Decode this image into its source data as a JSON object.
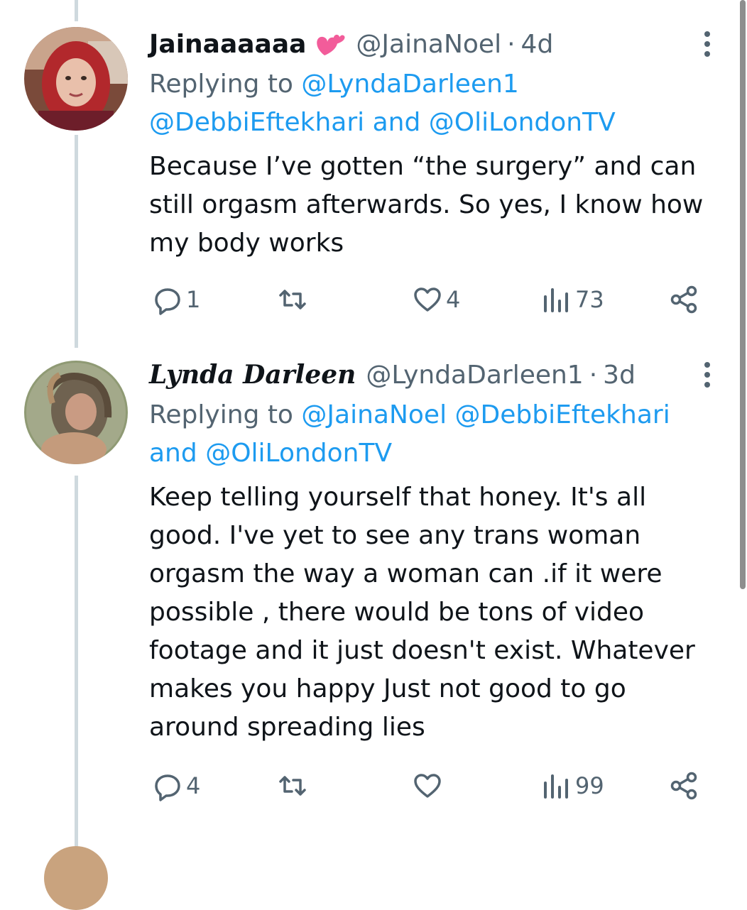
{
  "tweets": [
    {
      "display_name": "Jainaaaaaa",
      "name_emoji": "two-hearts",
      "handle": "@JainaNoel",
      "separator": "·",
      "time": "4d",
      "reply_prefix": "Replying to",
      "reply_mentions_line1": "@LyndaDarleen1",
      "reply_mentions_line2a": "@DebbiEftekhari",
      "reply_and": "and",
      "reply_mentions_line2b": "@OliLondonTV",
      "body_lines": [
        "Because I’ve gotten “the surgery” and can",
        "still orgasm afterwards. So yes, I know how",
        "my body works"
      ],
      "replies": "1",
      "retweets": "",
      "likes": "4",
      "views": "73"
    },
    {
      "display_name": "Lynda Darleen",
      "handle": "@LyndaDarleen1",
      "separator": "·",
      "time": "3d",
      "reply_prefix": "Replying to",
      "reply_mentions_line1a": "@JainaNoel",
      "reply_mentions_line1b": "@DebbiEftekhari",
      "reply_and": "and",
      "reply_mentions_line2": "@OliLondonTV",
      "body_lines": [
        "Keep telling yourself that honey. It's all",
        "good. I've yet to see any trans woman",
        "orgasm the way a woman can .if it were",
        "possible , there would be tons of video",
        "footage and it just doesn't exist. Whatever",
        "makes you happy  Just not good to go",
        "around spreading lies"
      ],
      "replies": "4",
      "retweets": "",
      "likes": "",
      "views": "99"
    }
  ],
  "icons": {
    "reply": "reply-icon",
    "retweet": "retweet-icon",
    "like": "heart-icon",
    "views": "views-icon",
    "share": "share-icon",
    "more": "more-icon"
  },
  "colors": {
    "text": "#0f1419",
    "muted": "#536471",
    "link": "#1d9bf0",
    "thread_line": "#cfd9de"
  }
}
